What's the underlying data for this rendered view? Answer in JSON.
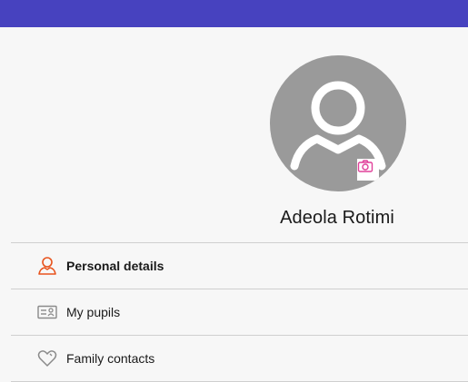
{
  "header": {
    "bar_color": "#4742bf"
  },
  "profile": {
    "name": "Adeola Rotimi",
    "avatar_icon": "user-silhouette-icon",
    "camera_icon": "camera-icon",
    "camera_color": "#e0409a"
  },
  "menu": {
    "items": [
      {
        "label": "Personal details",
        "icon": "person-icon",
        "active": true,
        "icon_color": "#e8541e"
      },
      {
        "label": "My pupils",
        "icon": "id-card-icon",
        "active": false,
        "icon_color": "#8a8a8a"
      },
      {
        "label": "Family contacts",
        "icon": "heart-icon",
        "active": false,
        "icon_color": "#8a8a8a"
      }
    ]
  }
}
